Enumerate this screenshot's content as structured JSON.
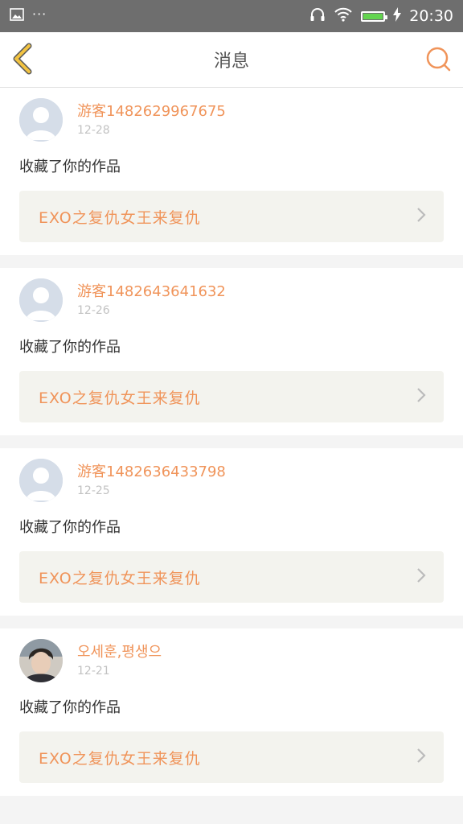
{
  "status_bar": {
    "time": "20:30",
    "dots": "···",
    "battery_level": 0.9
  },
  "header": {
    "title": "消息"
  },
  "colors": {
    "accent": "#f0945a",
    "back_arrow": "#f2c342"
  },
  "messages": [
    {
      "username": "游客1482629967675",
      "date": "12-28",
      "action": "收藏了你的作品",
      "work_title": "EXO之复仇女王来复仇",
      "avatar": "default"
    },
    {
      "username": "游客1482643641632",
      "date": "12-26",
      "action": "收藏了你的作品",
      "work_title": "EXO之复仇女王来复仇",
      "avatar": "default"
    },
    {
      "username": "游客1482636433798",
      "date": "12-25",
      "action": "收藏了你的作品",
      "work_title": "EXO之复仇女王来复仇",
      "avatar": "default"
    },
    {
      "username": "오세훈,평생으",
      "date": "12-21",
      "action": "收藏了你的作品",
      "work_title": "EXO之复仇女王来复仇",
      "avatar": "photo"
    }
  ]
}
